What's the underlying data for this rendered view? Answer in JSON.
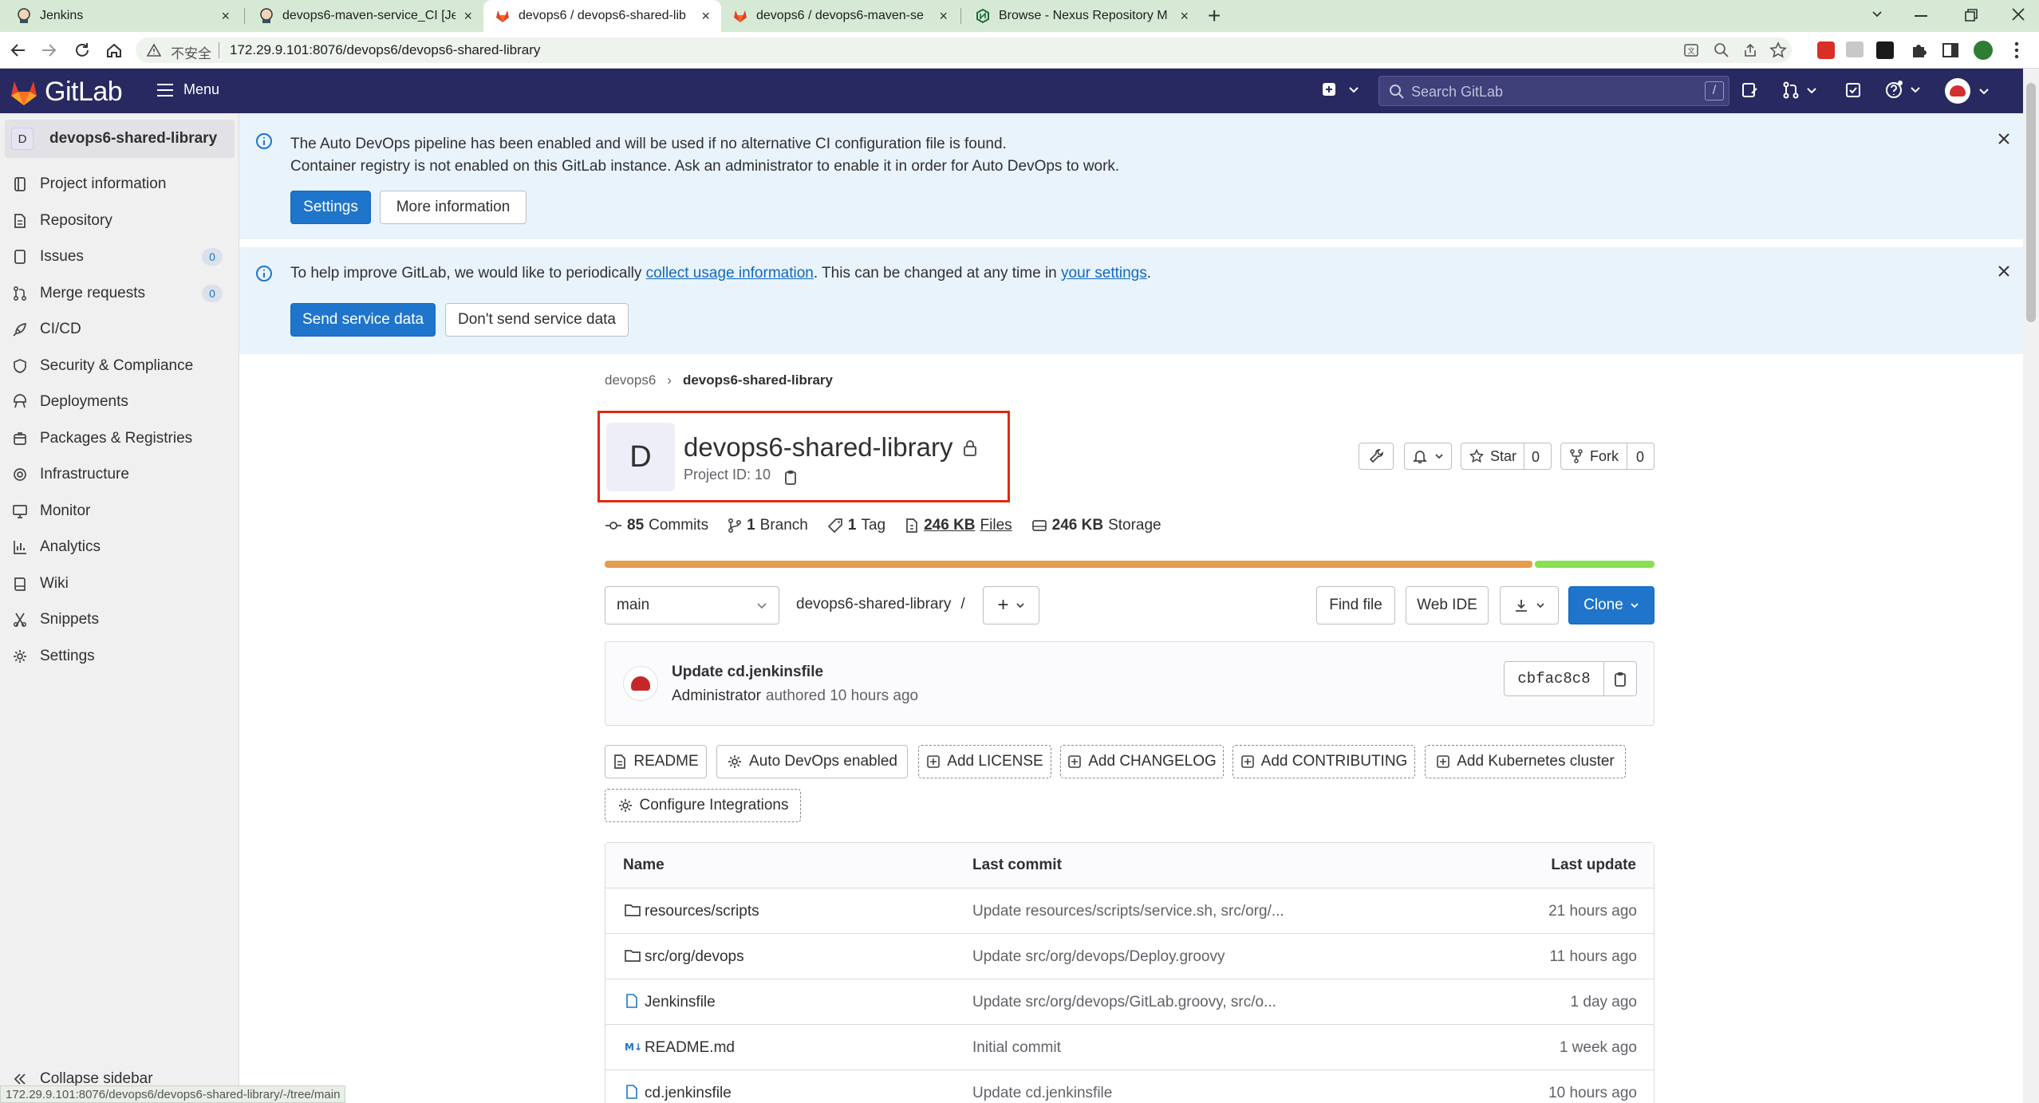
{
  "browser": {
    "tabs": [
      {
        "title": "Jenkins",
        "icon": "jenkins-icon"
      },
      {
        "title": "devops6-maven-service_CI [Je",
        "icon": "jenkins-icon"
      },
      {
        "title": "devops6 / devops6-shared-lib",
        "icon": "gitlab-icon",
        "active": true
      },
      {
        "title": "devops6 / devops6-maven-se",
        "icon": "gitlab-icon"
      },
      {
        "title": "Browse - Nexus Repository M",
        "icon": "nexus-icon"
      }
    ],
    "new_tab": "+",
    "close": "×",
    "insecure_label": "不安全",
    "url": "172.29.9.101:8076/devops6/devops6-shared-library",
    "status_url": "172.29.9.101:8076/devops6/devops6-shared-library/-/tree/main"
  },
  "topbar": {
    "brand": "GitLab",
    "menu_label": "Menu",
    "search_placeholder": "Search GitLab",
    "search_shortcut": "/"
  },
  "sidebar": {
    "project_initial": "D",
    "project_name": "devops6-shared-library",
    "items": [
      {
        "label": "Project information",
        "icon": "info-icon"
      },
      {
        "label": "Repository",
        "icon": "repository-icon"
      },
      {
        "label": "Issues",
        "icon": "issues-icon",
        "count": "0"
      },
      {
        "label": "Merge requests",
        "icon": "merge-request-icon",
        "count": "0"
      },
      {
        "label": "CI/CD",
        "icon": "rocket-icon"
      },
      {
        "label": "Security & Compliance",
        "icon": "shield-icon"
      },
      {
        "label": "Deployments",
        "icon": "deployments-icon"
      },
      {
        "label": "Packages & Registries",
        "icon": "package-icon"
      },
      {
        "label": "Infrastructure",
        "icon": "cloud-icon"
      },
      {
        "label": "Monitor",
        "icon": "monitor-icon"
      },
      {
        "label": "Analytics",
        "icon": "analytics-icon"
      },
      {
        "label": "Wiki",
        "icon": "book-icon"
      },
      {
        "label": "Snippets",
        "icon": "snippet-icon"
      },
      {
        "label": "Settings",
        "icon": "gear-icon"
      }
    ],
    "collapse_label": "Collapse sidebar"
  },
  "alerts": {
    "devops": {
      "line1": "The Auto DevOps pipeline has been enabled and will be used if no alternative CI configuration file is found.",
      "line2": "Container registry is not enabled on this GitLab instance. Ask an administrator to enable it in order for Auto DevOps to work.",
      "settings_button": "Settings",
      "more_button": "More information"
    },
    "usage": {
      "text_before": "To help improve GitLab, we would like to periodically ",
      "link1": "collect usage information",
      "text_middle": ". This can be changed at any time in ",
      "link2": "your settings",
      "text_after": ".",
      "send_button": "Send service data",
      "dont_send_button": "Don't send service data"
    }
  },
  "breadcrumb": {
    "group": "devops6",
    "project": "devops6-shared-library",
    "separator": "›"
  },
  "project": {
    "avatar_letter": "D",
    "name": "devops6-shared-library",
    "project_id_label": "Project ID: 10",
    "star_label": "Star",
    "star_count": "0",
    "fork_label": "Fork",
    "fork_count": "0",
    "highlight_color": "#dd2b0e"
  },
  "stats": {
    "commits_num": "85",
    "commits_label": "Commits",
    "branch_num": "1",
    "branch_label": "Branch",
    "tag_num": "1",
    "tag_label": "Tag",
    "files_size": "246 KB",
    "files_label": "Files",
    "storage_size": "246 KB",
    "storage_label": "Storage"
  },
  "language_bar": [
    {
      "fraction": 0.886,
      "color": "#e69c4d"
    },
    {
      "fraction": 0.114,
      "color": "#89e051"
    }
  ],
  "repo_toolbar": {
    "branch": "main",
    "path": "devops6-shared-library",
    "path_sep": "/",
    "add": "+",
    "find_file": "Find file",
    "web_ide": "Web IDE",
    "clone": "Clone"
  },
  "last_commit": {
    "title": "Update cd.jenkinsfile",
    "author": "Administrator",
    "authored": "authored 10 hours ago",
    "sha": "cbfac8c8"
  },
  "quick_actions": [
    {
      "label": "README",
      "icon": "doc-icon",
      "style": "solid"
    },
    {
      "label": "Auto DevOps enabled",
      "icon": "gear-icon",
      "style": "solid"
    },
    {
      "label": "Add LICENSE",
      "icon": "plus-square-icon",
      "style": "dashed"
    },
    {
      "label": "Add CHANGELOG",
      "icon": "plus-square-icon",
      "style": "dashed"
    },
    {
      "label": "Add CONTRIBUTING",
      "icon": "plus-square-icon",
      "style": "dashed"
    },
    {
      "label": "Add Kubernetes cluster",
      "icon": "plus-square-icon",
      "style": "dashed"
    },
    {
      "label": "Configure Integrations",
      "icon": "gear-icon",
      "style": "dashed"
    }
  ],
  "file_table": {
    "headers": {
      "name": "Name",
      "last_commit": "Last commit",
      "last_update": "Last update"
    },
    "rows": [
      {
        "name": "resources/scripts",
        "type": "folder",
        "commit": "Update resources/scripts/service.sh, src/org/...",
        "updated": "21 hours ago"
      },
      {
        "name": "src/org/devops",
        "type": "folder",
        "commit": "Update src/org/devops/Deploy.groovy",
        "updated": "11 hours ago"
      },
      {
        "name": "Jenkinsfile",
        "type": "file",
        "commit": "Update src/org/devops/GitLab.groovy, src/o...",
        "updated": "1 day ago"
      },
      {
        "name": "README.md",
        "type": "markdown",
        "commit": "Initial commit",
        "updated": "1 week ago"
      },
      {
        "name": "cd.jenkinsfile",
        "type": "file",
        "commit": "Update cd.jenkinsfile",
        "updated": "10 hours ago"
      }
    ]
  }
}
